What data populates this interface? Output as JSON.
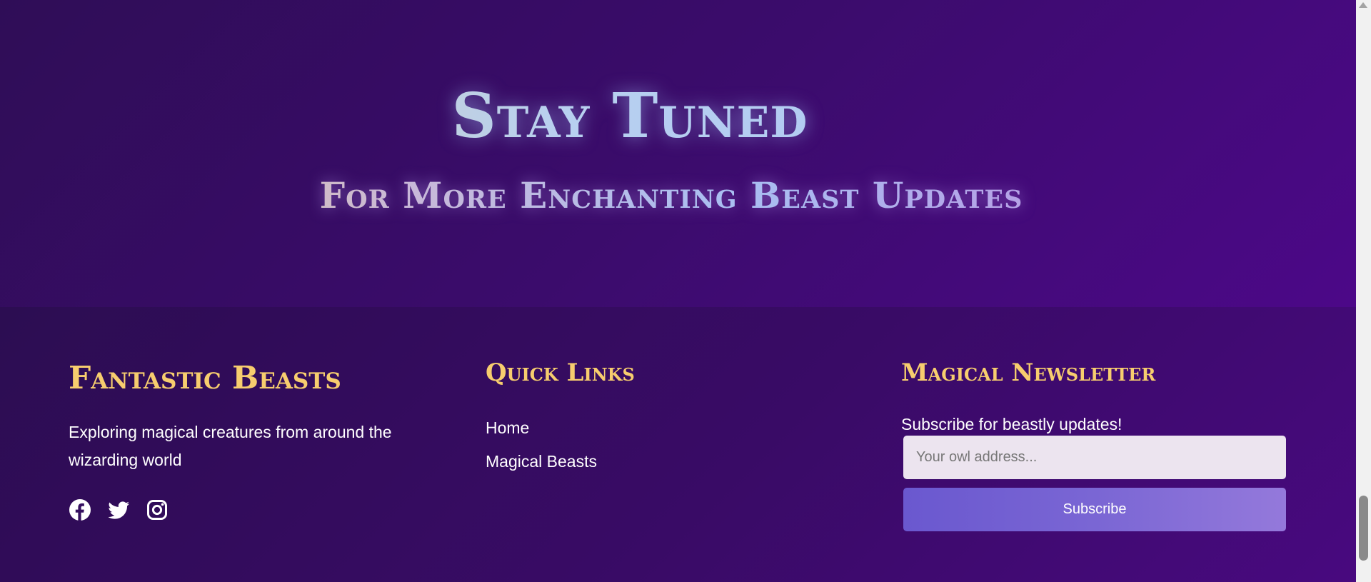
{
  "hero": {
    "title": "Stay Tuned",
    "subtitle": "For More Enchanting Beast Updates"
  },
  "footer": {
    "brand": {
      "title": "Fantastic Beasts",
      "description": "Exploring magical creatures from around the wizarding world",
      "socials": [
        "facebook-icon",
        "twitter-icon",
        "instagram-icon"
      ]
    },
    "quick_links": {
      "title": "Quick Links",
      "items": [
        "Home",
        "Magical Beasts"
      ]
    },
    "newsletter": {
      "title": "Magical Newsletter",
      "text": "Subscribe for beastly updates!",
      "placeholder": "Your owl address...",
      "button_label": "Subscribe"
    }
  },
  "colors": {
    "gold": "#f7cd6e",
    "background_dark": "#2e0f57",
    "background_light": "#4a0a85",
    "button": "#7a66d4",
    "input": "#ece4ef"
  }
}
